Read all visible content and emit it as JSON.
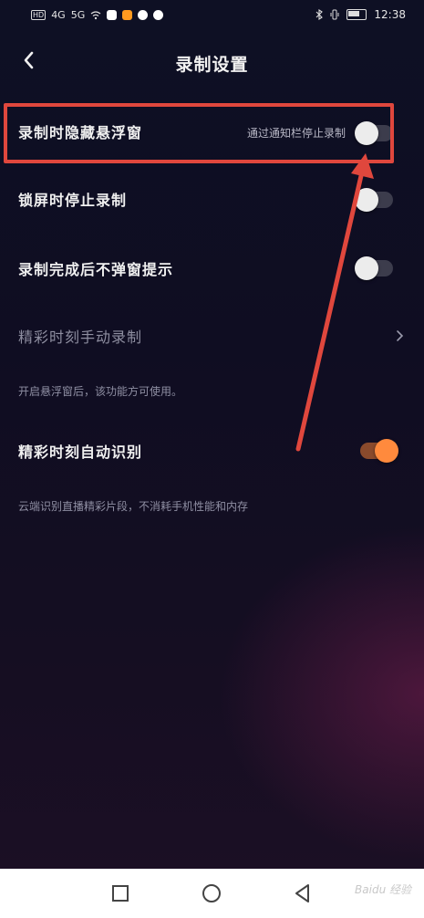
{
  "status_bar": {
    "left_tags": [
      "HD",
      "4G",
      "5G"
    ],
    "time": "12:38"
  },
  "header": {
    "title": "录制设置",
    "back_icon": "chevron-left-icon"
  },
  "settings": {
    "hide_float": {
      "label": "录制时隐藏悬浮窗",
      "sublabel": "通过通知栏停止录制",
      "on": false
    },
    "lock_stop": {
      "label": "锁屏时停止录制",
      "on": false
    },
    "no_popup": {
      "label": "录制完成后不弹窗提示",
      "on": false
    },
    "manual_highlight": {
      "label": "精彩时刻手动录制",
      "hint": "开启悬浮窗后，该功能方可使用。"
    },
    "auto_highlight": {
      "label": "精彩时刻自动识别",
      "hint": "云端识别直播精彩片段，不消耗手机性能和内存",
      "on": true
    }
  },
  "annotation": {
    "color": "#e0473d"
  },
  "colors": {
    "toggle_on": "#ff8a3d",
    "toggle_off_knob": "#ececec",
    "background": "#0e1024"
  },
  "system_nav": {
    "watermark": "Baidu 经验"
  }
}
